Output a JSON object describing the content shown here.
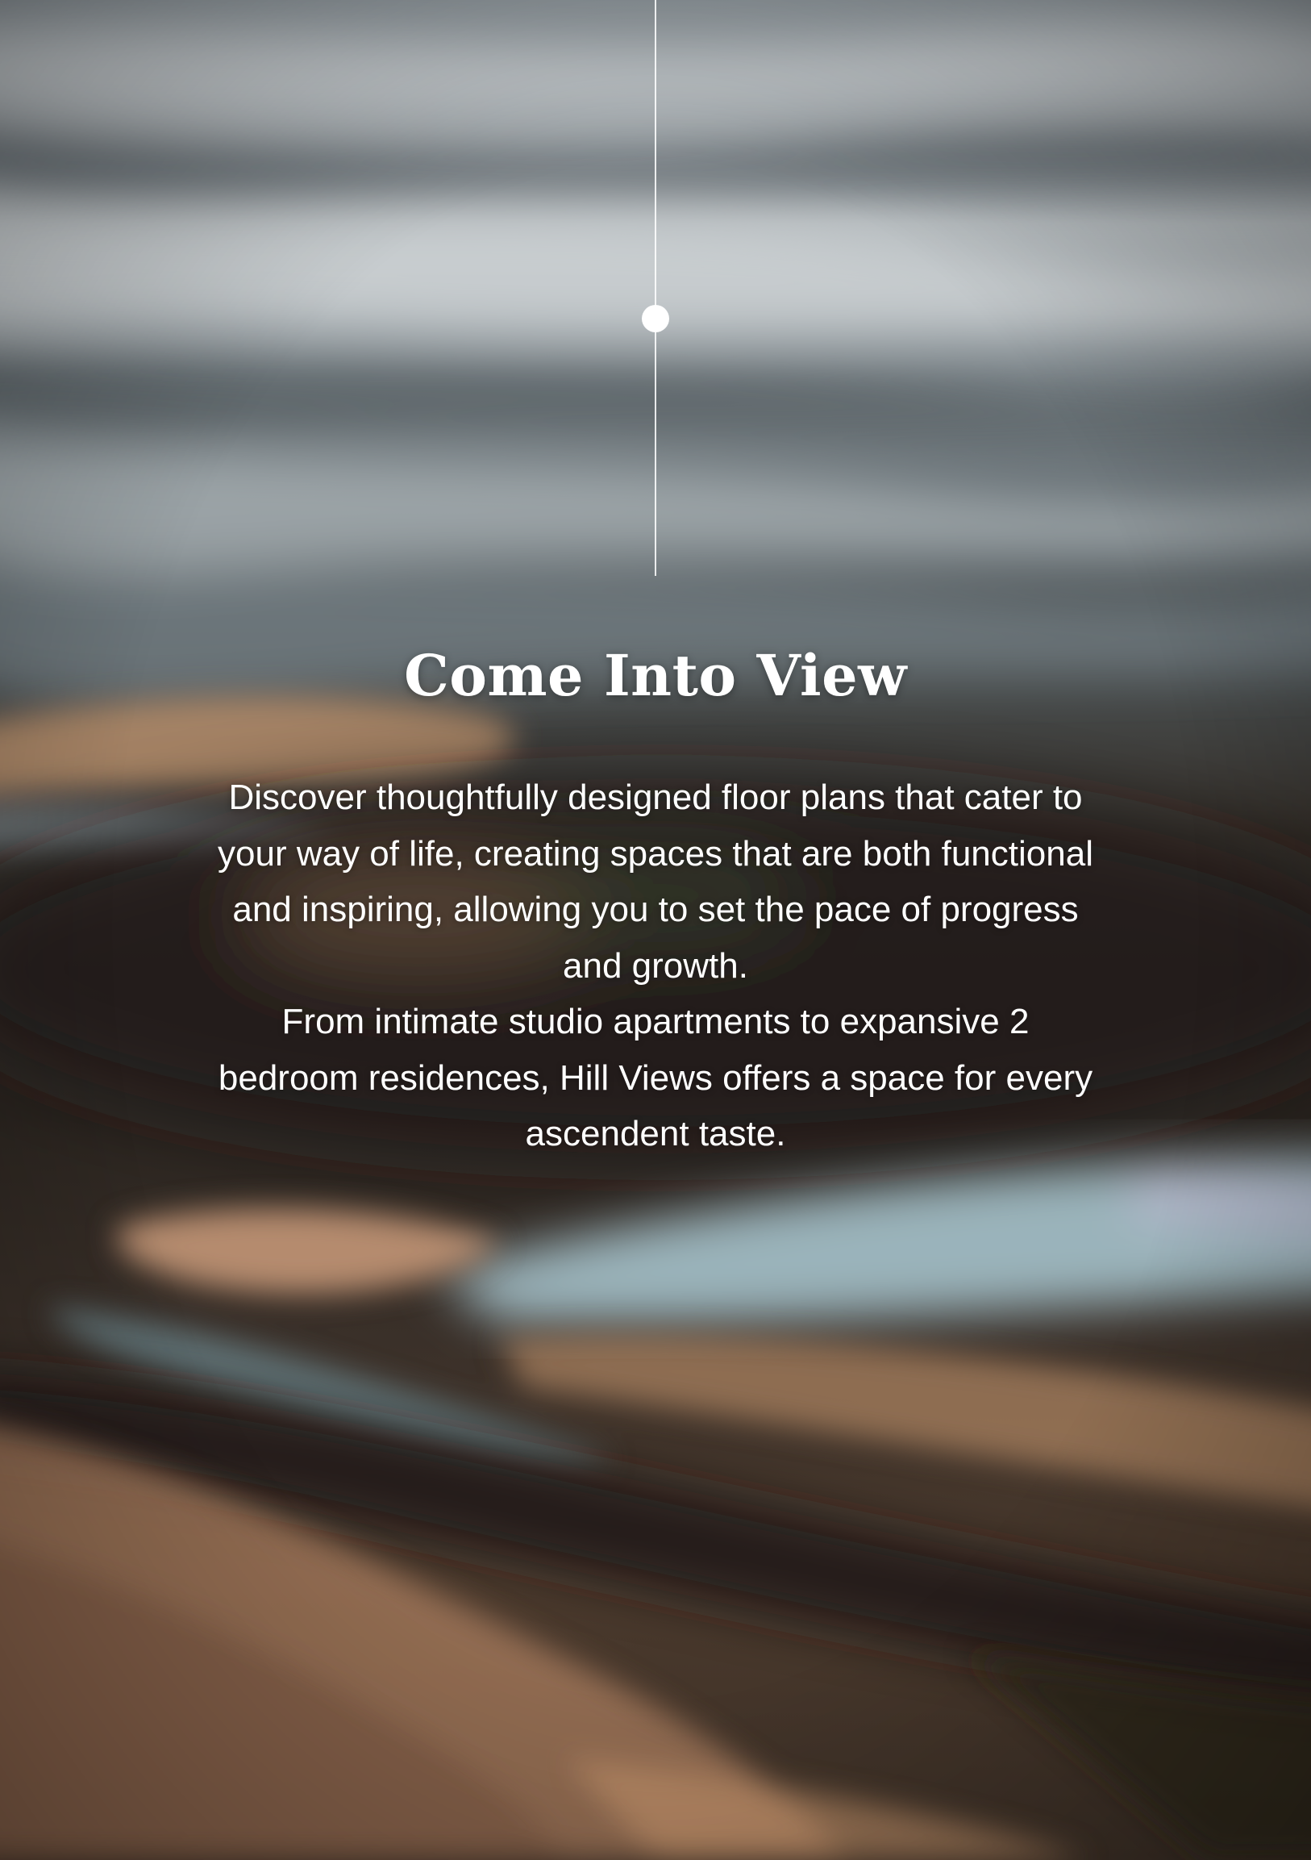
{
  "title": "Come Into View",
  "paragraphs": [
    "Discover thoughtfully designed floor plans that cater to your way of life, creating spaces that are both functional and inspiring, allowing you to set the pace of progress and growth.",
    "From intimate studio apartments to expansive 2 bedroom residences, Hill Views offers a space for every ascendent taste."
  ],
  "background": {
    "description_icon": "blurred-water-photo",
    "colors": {
      "sky_gray": "#8e979c",
      "silver": "#c9ced1",
      "dark_brown": "#2b241d",
      "sand": "#b48d6d",
      "aqua": "#a9c6cf"
    }
  }
}
